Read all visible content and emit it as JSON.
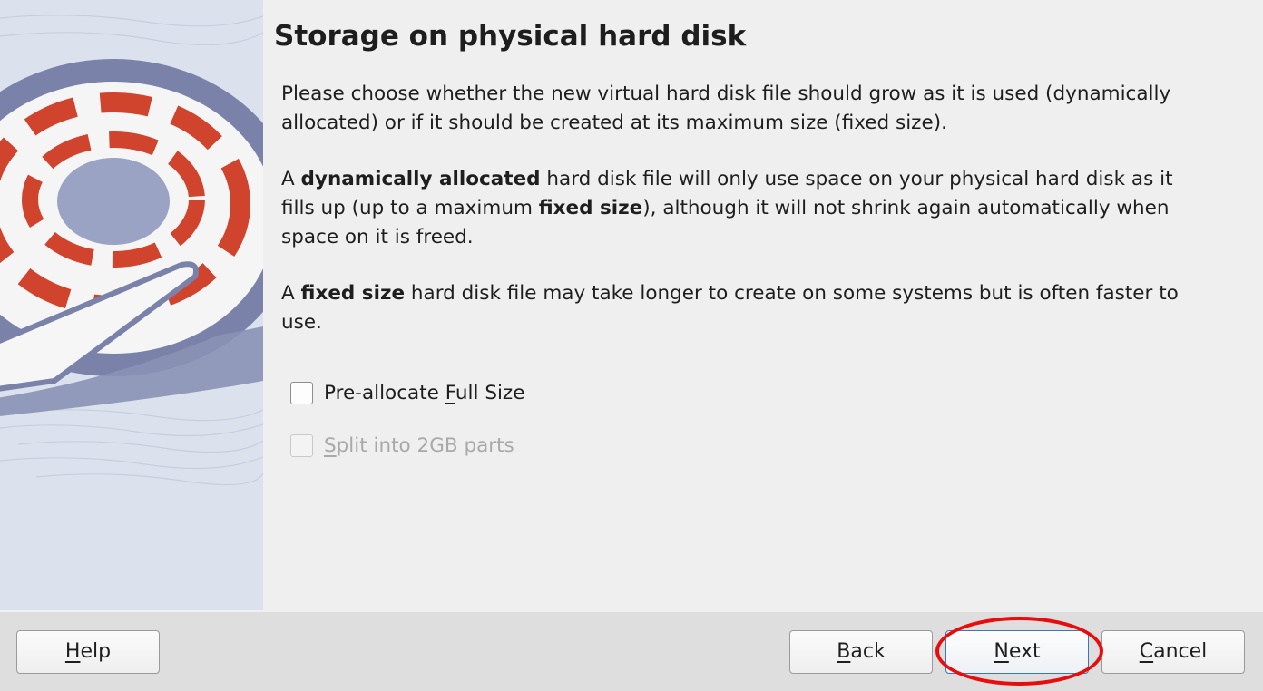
{
  "wizard": {
    "title": "Storage on physical hard disk",
    "intro": "Please choose whether the new virtual hard disk file should grow as it is used (dynamically allocated) or if it should be created at its maximum size (fixed size).",
    "dynamic_para": {
      "p1": "A ",
      "b1": "dynamically allocated",
      "p2": " hard disk file will only use space on your physical hard disk as it fills up (up to a maximum ",
      "b2": "fixed size",
      "p3": "), although it will not shrink again automatically when space on it is freed."
    },
    "fixed_para": {
      "p1": "A ",
      "b1": "fixed size",
      "p2": " hard disk file may take longer to create on some systems but is often faster to use."
    }
  },
  "options": {
    "preallocate": {
      "label_pre": "Pre-allocate ",
      "label_mnemonic": "F",
      "label_post": "ull Size",
      "checked": false,
      "enabled": true
    },
    "split": {
      "label_mnemonic": "S",
      "label_post": "plit into 2GB parts",
      "checked": false,
      "enabled": false
    }
  },
  "buttons": {
    "help": {
      "mnemonic": "H",
      "rest": "elp"
    },
    "back": {
      "mnemonic": "B",
      "rest": "ack"
    },
    "next": {
      "mnemonic": "N",
      "rest": "ext"
    },
    "cancel": {
      "mnemonic": "C",
      "rest": "ancel"
    }
  },
  "colors": {
    "highlight": "#e80d0d",
    "disk_red": "#d0432d",
    "disk_blue": "#7880a8",
    "panel_bg": "#dbe2ee"
  },
  "icons": {
    "side_illustration": "hard-disk-illustration"
  }
}
